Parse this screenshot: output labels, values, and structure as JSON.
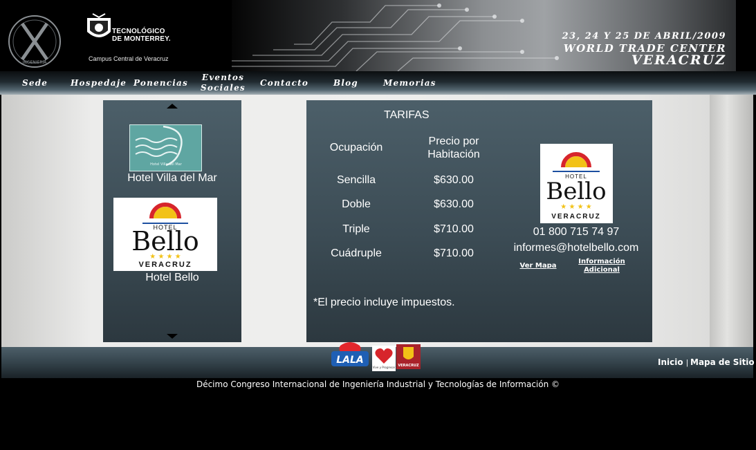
{
  "header": {
    "tec_line1": "TECNOLÓGICO",
    "tec_line2": "DE MONTERREY.",
    "campus": "Campus Central de Veracruz",
    "event_date": "23, 24 Y 25 DE ABRIL/2009",
    "event_place": "WORLD TRADE CENTER",
    "event_city": "VERACRUZ",
    "emblem_text": "INGENIERIA"
  },
  "nav": {
    "items": [
      {
        "label": "Sede"
      },
      {
        "label": "Hospedaje"
      },
      {
        "label": "Ponencias"
      },
      {
        "label": "Eventos"
      },
      {
        "label": "Sociales"
      },
      {
        "label": "Contacto"
      },
      {
        "label": "Blog"
      },
      {
        "label": "Memorias"
      }
    ]
  },
  "hotel_list": {
    "hotels": [
      {
        "name": "Hotel Villa del Mar",
        "logo_text": "Hotel Villa del Mar"
      },
      {
        "name": "Hotel Bello"
      }
    ]
  },
  "bello_logo": {
    "hotel": "HOTEL",
    "name": "Bello",
    "stars": "★ ★ ★ ★",
    "city": "VERACRUZ"
  },
  "rates": {
    "title": "TARIFAS",
    "col_occupancy": "Ocupación",
    "col_price_line1": "Precio por",
    "col_price_line2": "Habitación",
    "rows": [
      {
        "occupancy": "Sencilla",
        "price": "$630.00"
      },
      {
        "occupancy": "Doble",
        "price": "$630.00"
      },
      {
        "occupancy": "Triple",
        "price": "$710.00"
      },
      {
        "occupancy": "Cuádruple",
        "price": "$710.00"
      }
    ],
    "footnote": "*El precio incluye impuestos.",
    "phone": "01 800 715 74 97",
    "email": "informes@hotelbello.com",
    "link_map": "Ver Mapa",
    "link_info_line1": "Información",
    "link_info_line2": "Adicional"
  },
  "sponsors": {
    "lala": "LALA",
    "heart_caption": "Vive y Progresar",
    "veracruz": "VERACRUZ"
  },
  "footer": {
    "link_home": "Inicio",
    "separator": "|",
    "link_sitemap": "Mapa de Sitio",
    "copyright": "Décimo Congreso Internacional de Ingeniería Industrial y Tecnologías de Información ©"
  },
  "colors": {
    "panel": "#3c4c55",
    "background": "#000000",
    "bello_red": "#d7252b",
    "bello_yellow": "#f2c217",
    "villa_teal": "#5fa6a2"
  }
}
